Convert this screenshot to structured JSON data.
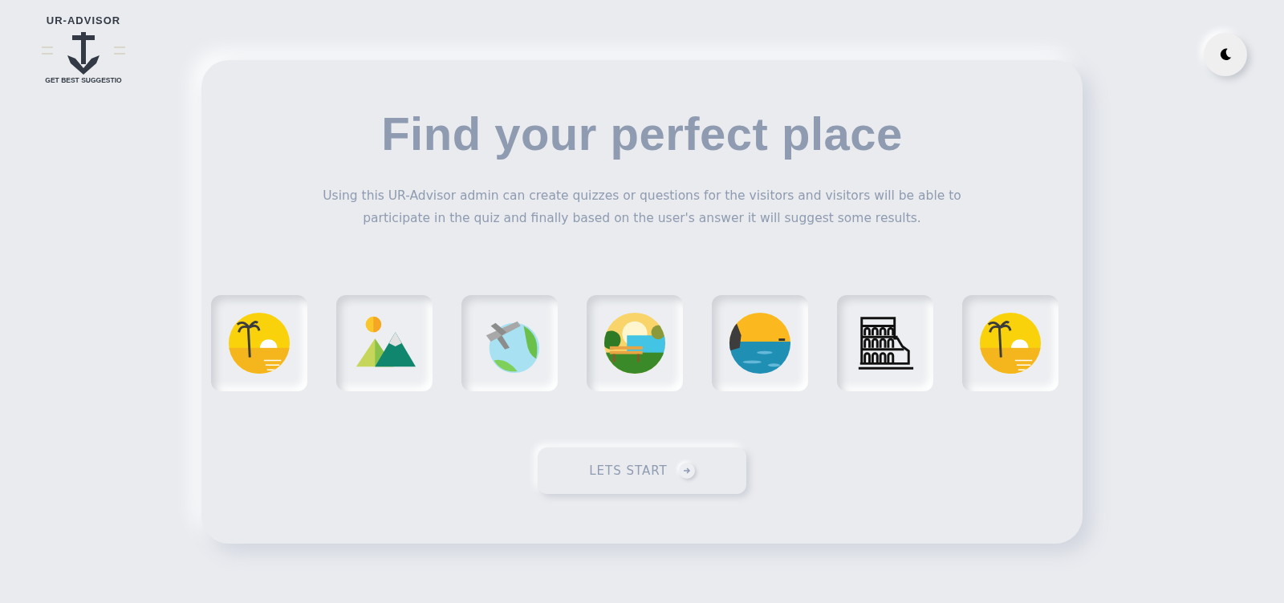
{
  "logo": {
    "title": "UR-ADVISOR",
    "tagline": "GET BEST SUGGESTIO"
  },
  "theme_toggle": {
    "dark": false
  },
  "hero": {
    "title": "Find your perfect place",
    "description": "Using this UR-Advisor admin can create quizzes or questions for the visitors and visitors will be able to participate in the quiz and finally based on the user's answer it will suggest some results."
  },
  "places": [
    {
      "kind": "beach"
    },
    {
      "kind": "mountain"
    },
    {
      "kind": "plane"
    },
    {
      "kind": "park"
    },
    {
      "kind": "coast"
    },
    {
      "kind": "colosseum"
    },
    {
      "kind": "beach"
    }
  ],
  "start_button": {
    "label": "LETS START"
  }
}
